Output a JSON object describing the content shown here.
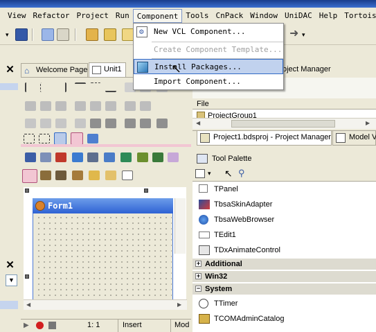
{
  "menubar": {
    "items": [
      "View",
      "Refactor",
      "Project",
      "Run",
      "Component",
      "Tools",
      "CnPack",
      "Window",
      "UniDAC",
      "Help",
      "TortoiseS"
    ],
    "active_index": 4
  },
  "component_menu": {
    "items": [
      {
        "label": "New VCL Component...",
        "enabled": true,
        "icon": "gear-page-icon"
      },
      {
        "label": "Create Component Template...",
        "enabled": false
      },
      {
        "label": "Install Packages...",
        "enabled": true,
        "highlighted": true,
        "icon": "package-icon"
      },
      {
        "label": "Import Component...",
        "enabled": true
      }
    ]
  },
  "editor": {
    "tabs": [
      {
        "label": "Welcome Page",
        "icon": "home-icon"
      },
      {
        "label": "Unit1",
        "icon": "unit-page-icon",
        "selected": true
      }
    ]
  },
  "form_designer": {
    "form_caption": "Form1"
  },
  "status_bar": {
    "position": "1:  1",
    "mode": "Insert",
    "modified": "Mod"
  },
  "project_manager": {
    "title_fragment": "oject Manager",
    "column_header": "File",
    "root_node": "ProjectGroup1",
    "tabs": [
      {
        "label": "Project1.bdsproj - Project Manager",
        "selected": true
      },
      {
        "label": "Model Vi"
      }
    ]
  },
  "tool_palette": {
    "title": "Tool Palette",
    "items": [
      {
        "label": "TPanel",
        "icon": "panel-icon"
      },
      {
        "label": "TbsaSkinAdapter",
        "icon": "skin-adapter-icon"
      },
      {
        "label": "TbsaWebBrowser",
        "icon": "web-browser-icon"
      },
      {
        "label": "TEdit1",
        "icon": "edit-icon"
      },
      {
        "label": "TDxAnimateControl",
        "icon": "animate-icon"
      }
    ],
    "categories": [
      {
        "label": "Additional",
        "expanded": false
      },
      {
        "label": "Win32",
        "expanded": false
      },
      {
        "label": "System",
        "expanded": true
      }
    ],
    "system_items": [
      {
        "label": "TTimer",
        "icon": "timer-icon"
      },
      {
        "label": "TCOMAdminCatalog",
        "icon": "com-admin-icon"
      }
    ]
  },
  "colors": {
    "menu_highlight": "#c1d2ee",
    "menu_highlight_border": "#316ac5",
    "form_title_start": "#6d9dea",
    "form_title_end": "#2e62d4",
    "window_bg": "#ece9d8"
  }
}
